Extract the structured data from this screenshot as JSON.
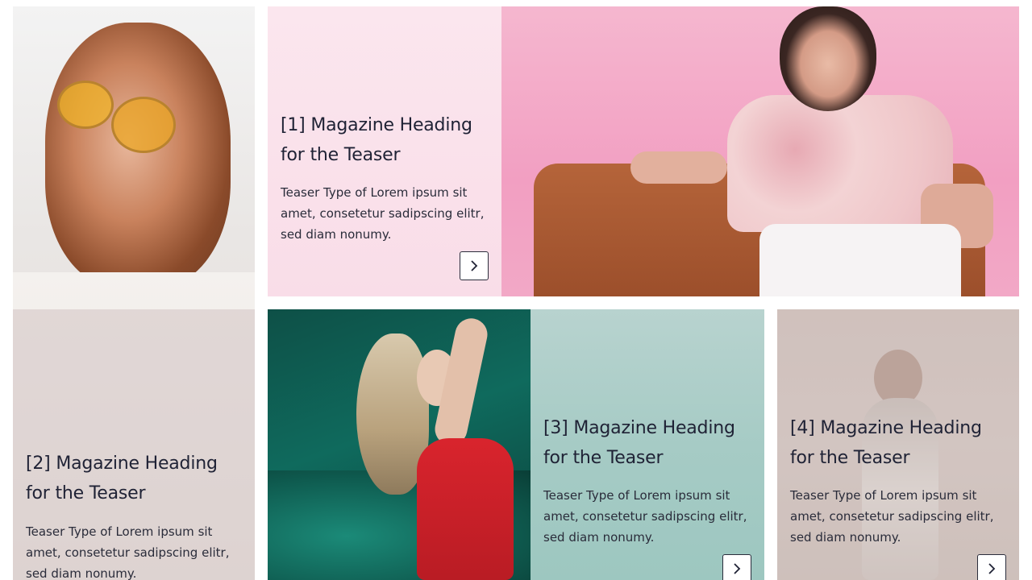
{
  "teasers": [
    {
      "heading": "[1] Magazine Heading for the Teaser",
      "text": "Teaser Type of Lorem ipsum sit amet, consetetur sadipscing elitr, sed diam nonumy."
    },
    {
      "heading": "[2] Magazine Heading for the Teaser",
      "text": "Teaser Type of Lorem ipsum sit amet, consetetur sadipscing elitr, sed diam nonumy."
    },
    {
      "heading": "[3] Magazine Heading for the Teaser",
      "text": "Teaser Type of Lorem ipsum sit amet, consetetur sadipscing elitr, sed diam nonumy."
    },
    {
      "heading": "[4] Magazine Heading for the Teaser",
      "text": "Teaser Type of Lorem ipsum sit amet, consetetur sadipscing elitr, sed diam nonumy."
    }
  ],
  "icons": {
    "next": "chevron-right-icon"
  },
  "colors": {
    "text": "#1f2235",
    "button_border": "#2b2d3c",
    "tile1_bg": "#fbe6ee",
    "tile3_bg": "#a6cbc5",
    "tile4_bg": "#cfc2bd"
  }
}
